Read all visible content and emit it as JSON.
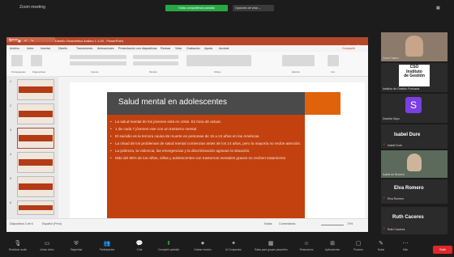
{
  "topbar": {
    "meeting_title": "Zoom meeting",
    "share_banner": "Estás compartiendo pantalla",
    "view_options": "Opciones de vista ⌄"
  },
  "powerpoint": {
    "window_title": "Diseño Geometrico Andino 1 1.00 - PowerPoint",
    "search_placeholder": "Buscar",
    "menu": [
      "Archivo",
      "Inicio",
      "Insertar",
      "Diseño",
      "Transiciones",
      "Animaciones",
      "Presentación con diapositivas",
      "Revisar",
      "Vista",
      "Grabación",
      "Ayuda",
      "Acrobat"
    ],
    "share_label": "Compartir",
    "ribbon_groups": [
      "Portapapeles",
      "Diapositivas",
      "Fuente",
      "Párrafo",
      "Dibujo",
      "Edición",
      "Voz"
    ],
    "slide_numbers": [
      "1",
      "2",
      "3",
      "4",
      "5",
      "6"
    ],
    "status_left": "Diapositiva 3 de 6",
    "status_lang": "Español (Perú)",
    "status_notes": "Notas",
    "status_comments": "Comentarios",
    "zoom_level": "74%"
  },
  "slide": {
    "title": "Salud mental en adolescentes",
    "bullets": [
      "La salud mental de los jóvenes está en crisis. Es hora de actuar.",
      "1 de cada 7 jóvenes vive con un trastorno mental.",
      "El suicidio es la tercera causa de muerte en personas de 15 a 24 años en las Américas.",
      "La mitad de los problemas de salud mental comienzan antes de los 14 años, pero la mayoría no recibe atención.",
      "La pobreza, la violencia, las emergencias y la discriminación agravan la situación.",
      "Más del 90% de los niños, niñas y adolescentes con trastornos mentales graves no reciben tratamiento"
    ]
  },
  "participants": [
    {
      "name": "Carol Castro",
      "type": "video"
    },
    {
      "name": "Instituto de Gestión Portuaria",
      "logo_text": "CSO\nInstituto\nde Gestión",
      "type": "logo"
    },
    {
      "name": "Daniela Sayo",
      "initial": "S",
      "type": "initial"
    },
    {
      "name": "Isabel Dure",
      "type": "name"
    },
    {
      "name": "Isabel de Bricerol",
      "type": "video"
    },
    {
      "name": "Elva Romero",
      "type": "name"
    },
    {
      "name": "Ruth Caceres",
      "type": "name"
    }
  ],
  "toolbar": [
    {
      "icon": "mic-icon",
      "label": "Reactivar audio"
    },
    {
      "icon": "video-icon",
      "label": "Iniciar video"
    },
    {
      "icon": "shield-icon",
      "label": "Seguridad"
    },
    {
      "icon": "participants-icon",
      "label": "Participantes"
    },
    {
      "icon": "chat-icon",
      "label": "Chat"
    },
    {
      "icon": "share-icon",
      "label": "Compartir pantalla"
    },
    {
      "icon": "record-icon",
      "label": "Grabar reunión"
    },
    {
      "icon": "ai-companion-icon",
      "label": "AI Companion"
    },
    {
      "icon": "rooms-icon",
      "label": "Salas para grupos pequeños"
    },
    {
      "icon": "reactions-icon",
      "label": "Reacciones"
    },
    {
      "icon": "apps-icon",
      "label": "Aplicaciones"
    },
    {
      "icon": "whiteboard-icon",
      "label": "Pizarras"
    },
    {
      "icon": "notes-icon",
      "label": "Notas"
    },
    {
      "icon": "more-icon",
      "label": "Más"
    }
  ],
  "leave_label": "Salir",
  "colors": {
    "ppt_brand": "#b7472a",
    "slide_orange": "#c2410f",
    "accent_orange": "#e0630c",
    "share_green": "#27a844",
    "leave_red": "#e02828"
  }
}
